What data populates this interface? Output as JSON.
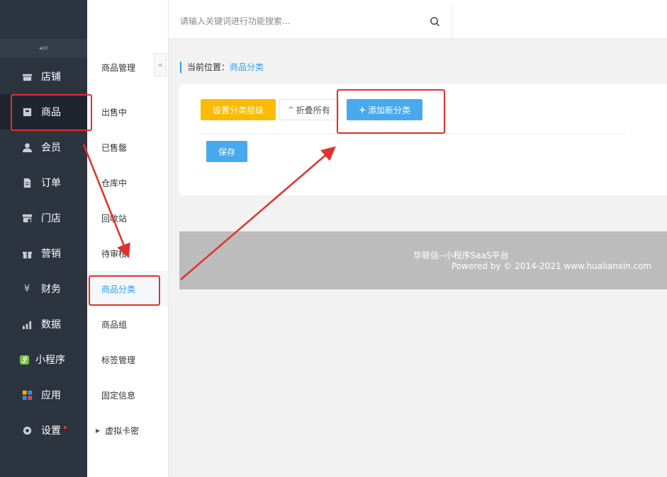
{
  "topbar": {
    "search_placeholder": "请输入关键词进行功能搜索..."
  },
  "nav": {
    "collapse_glyph": "◂≡",
    "items": [
      {
        "label": "店铺",
        "icon": "shop-icon"
      },
      {
        "label": "商品",
        "icon": "bag-icon"
      },
      {
        "label": "会员",
        "icon": "user-icon"
      },
      {
        "label": "订单",
        "icon": "document-icon"
      },
      {
        "label": "门店",
        "icon": "store-icon"
      },
      {
        "label": "营销",
        "icon": "gift-icon"
      },
      {
        "label": "财务",
        "icon": "money-bag-icon"
      },
      {
        "label": "数据",
        "icon": "chart-icon"
      },
      {
        "label": "小程序",
        "icon": "miniprogram-icon"
      },
      {
        "label": "应用",
        "icon": "apps-icon"
      },
      {
        "label": "设置",
        "icon": "gear-icon"
      }
    ]
  },
  "subnav": {
    "title": "商品管理",
    "items": [
      {
        "label": "出售中"
      },
      {
        "label": "已售罄"
      },
      {
        "label": "仓库中"
      },
      {
        "label": "回收站"
      },
      {
        "label": "待审核"
      },
      {
        "label": "商品分类"
      },
      {
        "label": "商品组"
      },
      {
        "label": "标签管理"
      },
      {
        "label": "固定信息"
      },
      {
        "label": "虚拟卡密"
      }
    ]
  },
  "breadcrumb": {
    "prefix": "当前位置：",
    "current": "商品分类"
  },
  "toolbar": {
    "set_level_label": "设置分类层级",
    "collapse_all_label": "折叠所有",
    "add_category_label": "添加新分类",
    "save_label": "保存"
  },
  "footer": {
    "line1": "华联信--小程序SaaS平台",
    "line2": "Powered by © 2014-2021 www.hualianxin.com"
  },
  "colors": {
    "nav_bg": "#2c3440",
    "accent": "#2d9ff0",
    "primary_button": "#48a9ee",
    "warning_button": "#fbbb00",
    "annotation_red": "#e4302b"
  }
}
